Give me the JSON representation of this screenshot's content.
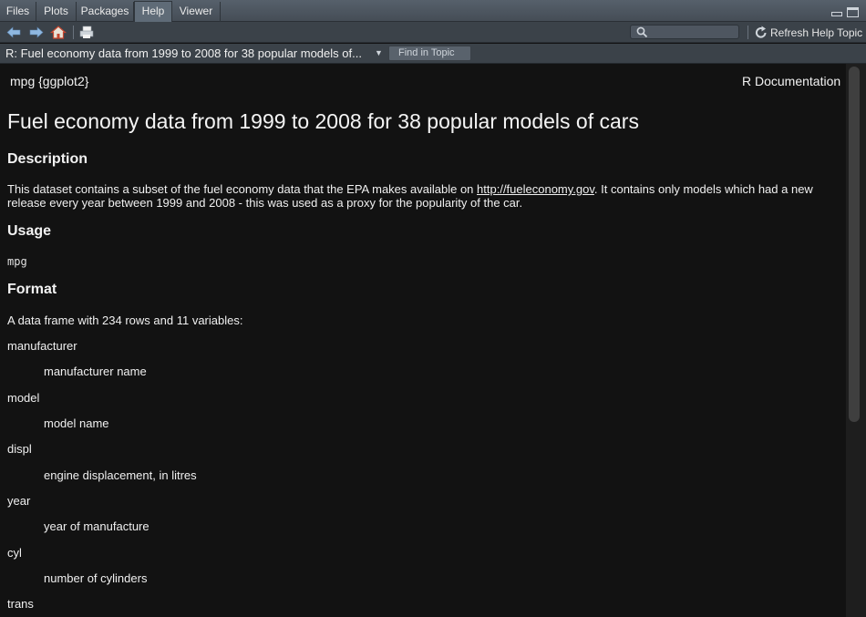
{
  "tabs": [
    {
      "label": "Files"
    },
    {
      "label": "Plots"
    },
    {
      "label": "Packages"
    },
    {
      "label": "Help"
    },
    {
      "label": "Viewer"
    }
  ],
  "active_tab": "Help",
  "toolbar": {
    "search_value": "",
    "refresh_label": "Refresh Help Topic",
    "icons": [
      "back-arrow-icon",
      "forward-arrow-icon",
      "home-icon",
      "print-icon",
      "search-icon",
      "refresh-icon"
    ]
  },
  "topic": {
    "title": "R: Fuel economy data from 1999 to 2008 for 38 popular models of...",
    "find_label": "Find in Topic"
  },
  "doc": {
    "header_left": "mpg {ggplot2}",
    "header_right": "R Documentation",
    "title": "Fuel economy data from 1999 to 2008 for 38 popular models of cars",
    "description_heading": "Description",
    "description_before_link": "This dataset contains a subset of the fuel economy data that the EPA makes available on ",
    "description_link": "http://fueleconomy.gov",
    "description_after_link": ". It contains only models which had a new release every year between 1999 and 2008 - this was used as a proxy for the popularity of the car.",
    "usage_heading": "Usage",
    "usage_code": "mpg",
    "format_heading": "Format",
    "format_text": "A data frame with 234 rows and 11 variables:",
    "variables": [
      {
        "name": "manufacturer",
        "desc": "manufacturer name"
      },
      {
        "name": "model",
        "desc": "model name"
      },
      {
        "name": "displ",
        "desc": "engine displacement, in litres"
      },
      {
        "name": "year",
        "desc": "year of manufacture"
      },
      {
        "name": "cyl",
        "desc": "number of cylinders"
      },
      {
        "name": "trans",
        "desc": ""
      }
    ]
  },
  "colors": {
    "background": "#121212",
    "toolbar": "#3b4249",
    "text": "#f0f0f0"
  }
}
